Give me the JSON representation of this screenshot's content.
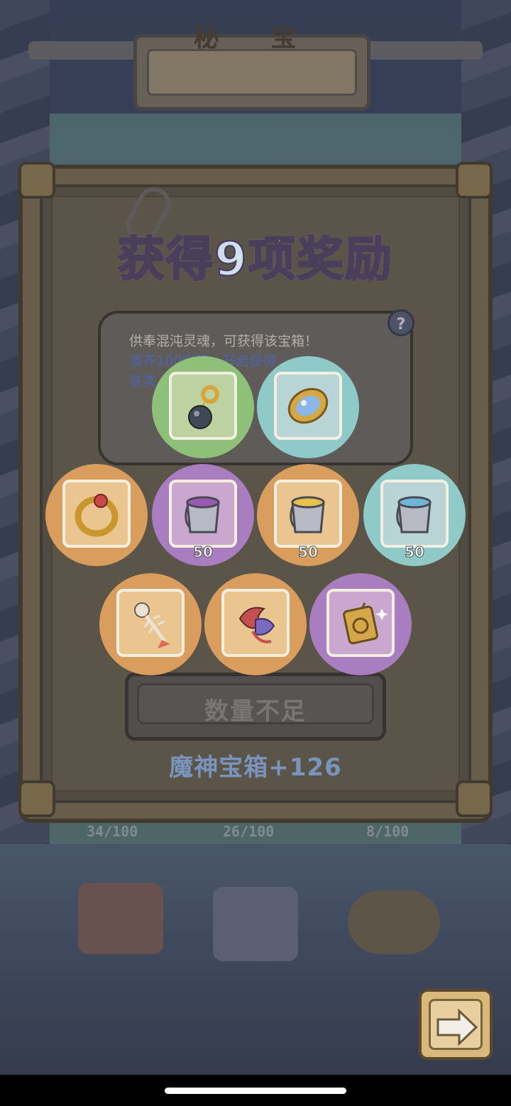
{
  "header": {
    "title": "秘 宝"
  },
  "panel": {
    "rewards_title": "获得9项奖励",
    "description": {
      "line1": "供奉混沌灵魂，可获得该宝箱！",
      "line2": "凑齐100宝箱，开启获得",
      "line3": "各类"
    },
    "help_label": "?"
  },
  "rewards": [
    {
      "item": "black-pearl-pendant",
      "rarity": "green",
      "count": ""
    },
    {
      "item": "blue-gem-mirror",
      "rarity": "cyan",
      "count": ""
    },
    {
      "item": "gold-ring",
      "rarity": "orange",
      "count": ""
    },
    {
      "item": "purple-paint-bucket",
      "rarity": "purple",
      "count": "50"
    },
    {
      "item": "yellow-paint-bucket",
      "rarity": "orange",
      "count": "50"
    },
    {
      "item": "cyan-paint-bucket",
      "rarity": "cyan",
      "count": "50"
    },
    {
      "item": "fish-bone",
      "rarity": "orange",
      "count": ""
    },
    {
      "item": "feather-wing",
      "rarity": "orange",
      "count": ""
    },
    {
      "item": "golden-amulet",
      "rarity": "purple",
      "count": ""
    }
  ],
  "button": {
    "insufficient_label": "数量不足"
  },
  "chest_count_text": "魔神宝箱+126",
  "progress": [
    "34/100",
    "26/100",
    "8/100"
  ],
  "colors": {
    "green": "#8fc07a",
    "cyan": "#8fc9c8",
    "orange": "#d99d5e",
    "purple": "#a87ec0",
    "card_green": "#bcd3a1",
    "card_cyan": "#b9d4d4",
    "card_orange": "#ebc58f",
    "card_purple": "#c9a7cf"
  }
}
